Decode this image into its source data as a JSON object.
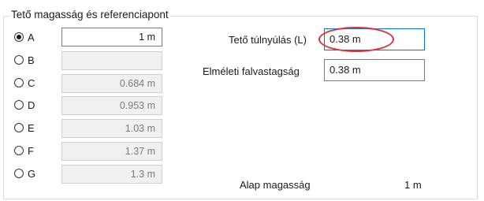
{
  "group": {
    "title": "Tető magasság és referenciapont"
  },
  "options": [
    {
      "label": "A",
      "value": "1 m",
      "checked": true
    },
    {
      "label": "B",
      "value": "",
      "checked": false
    },
    {
      "label": "C",
      "value": "0.684 m",
      "checked": false
    },
    {
      "label": "D",
      "value": "0.953 m",
      "checked": false
    },
    {
      "label": "E",
      "value": "1.03 m",
      "checked": false
    },
    {
      "label": "F",
      "value": "1.37 m",
      "checked": false
    },
    {
      "label": "G",
      "value": "1.3 m",
      "checked": false
    }
  ],
  "overhang": {
    "label": "Tető túlnyúlás (L)",
    "value": "0.38 m"
  },
  "wall": {
    "label": "Elméleti falvastagság",
    "value": "0.38 m"
  },
  "base": {
    "label": "Alap magasság",
    "value": "1 m"
  },
  "colors": {
    "annotation": "#e0303a",
    "focus": "#0078d7"
  }
}
